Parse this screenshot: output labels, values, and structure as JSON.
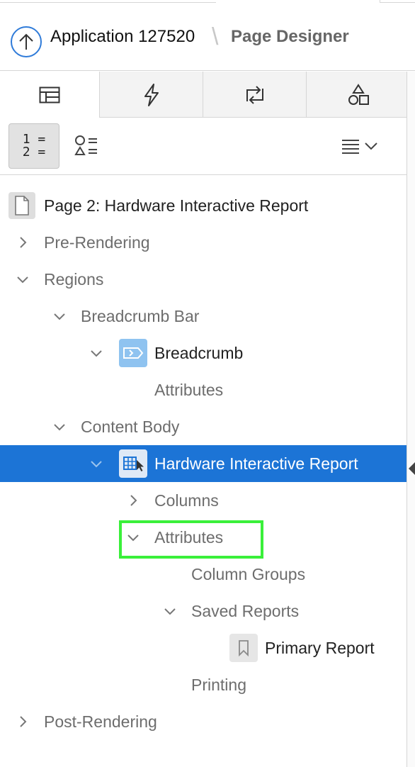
{
  "header": {
    "app_title": "Application 127520",
    "separator": "\\",
    "page_title": "Page Designer"
  },
  "tabs": [
    {
      "name": "rendering",
      "icon": "rendering-tree-icon",
      "active": true
    },
    {
      "name": "dynamic-actions",
      "icon": "lightning-bolt-icon",
      "active": false
    },
    {
      "name": "processing",
      "icon": "processing-arrows-icon",
      "active": false
    },
    {
      "name": "shared-components",
      "icon": "shapes-icon",
      "active": false
    }
  ],
  "toolbar": {
    "order_view_label_1": "1 =",
    "order_view_label_2": "2 =",
    "icons": [
      "numbered-list-icon",
      "grouped-list-icon",
      "menu-icon",
      "chevron-down-icon"
    ]
  },
  "tree": {
    "page_node": "Page 2: Hardware Interactive Report",
    "pre_rendering": "Pre-Rendering",
    "regions": "Regions",
    "breadcrumb_bar": "Breadcrumb Bar",
    "breadcrumb": "Breadcrumb",
    "breadcrumb_attributes": "Attributes",
    "content_body": "Content Body",
    "report_region": "Hardware Interactive Report",
    "columns": "Columns",
    "report_attributes": "Attributes",
    "column_groups": "Column Groups",
    "saved_reports": "Saved Reports",
    "primary_report": "Primary Report",
    "printing": "Printing",
    "post_rendering": "Post-Rendering"
  },
  "colors": {
    "accent": "#1c74d6",
    "highlight": "#3af03a",
    "icon_blue": "#2f7bd9"
  }
}
